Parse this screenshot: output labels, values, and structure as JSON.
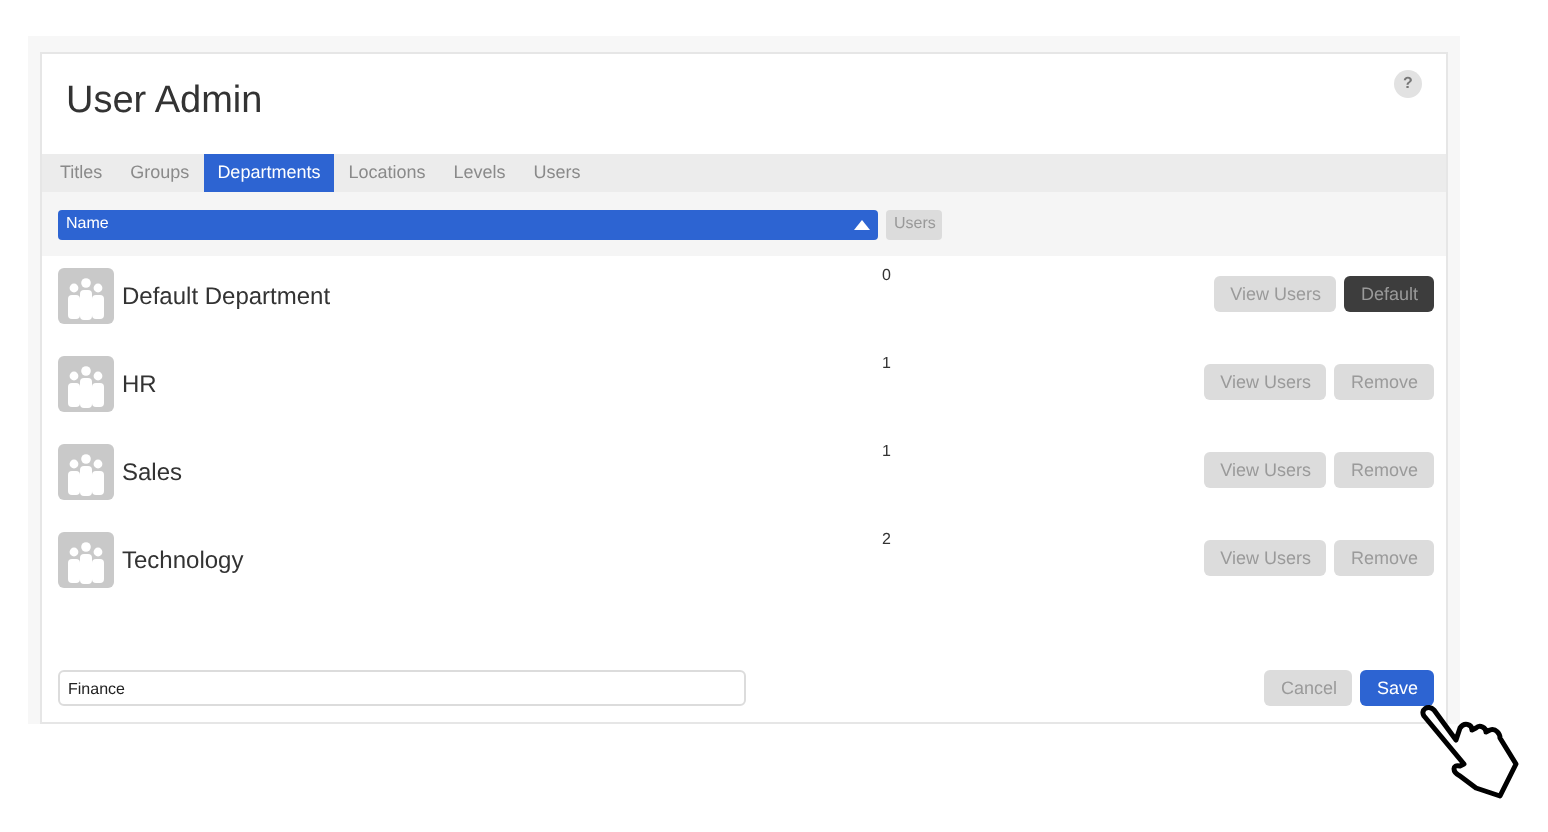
{
  "page": {
    "title": "User Admin",
    "help": "?"
  },
  "tabs": [
    {
      "label": "Titles",
      "selected": false
    },
    {
      "label": "Groups",
      "selected": false
    },
    {
      "label": "Departments",
      "selected": true
    },
    {
      "label": "Locations",
      "selected": false
    },
    {
      "label": "Levels",
      "selected": false
    },
    {
      "label": "Users",
      "selected": false
    }
  ],
  "table": {
    "columns": [
      {
        "label": "Name",
        "selected": true
      },
      {
        "label": "Users",
        "selected": false
      }
    ],
    "rows": [
      {
        "name": "Default Department",
        "users": "0",
        "buttons": [
          {
            "label": "View Users",
            "kind": "secondary"
          },
          {
            "label": "Default",
            "kind": "dark"
          }
        ]
      },
      {
        "name": "HR",
        "users": "1",
        "buttons": [
          {
            "label": "View Users",
            "kind": "secondary"
          },
          {
            "label": "Remove",
            "kind": "secondary"
          }
        ]
      },
      {
        "name": "Sales",
        "users": "1",
        "buttons": [
          {
            "label": "View Users",
            "kind": "secondary"
          },
          {
            "label": "Remove",
            "kind": "secondary"
          }
        ]
      },
      {
        "name": "Technology",
        "users": "2",
        "buttons": [
          {
            "label": "View Users",
            "kind": "secondary"
          },
          {
            "label": "Remove",
            "kind": "secondary"
          }
        ]
      }
    ]
  },
  "new_department": {
    "value": "Finance"
  },
  "buttons": [
    {
      "label": "Cancel",
      "kind": "secondary"
    },
    {
      "label": "Save",
      "kind": "primary"
    }
  ]
}
